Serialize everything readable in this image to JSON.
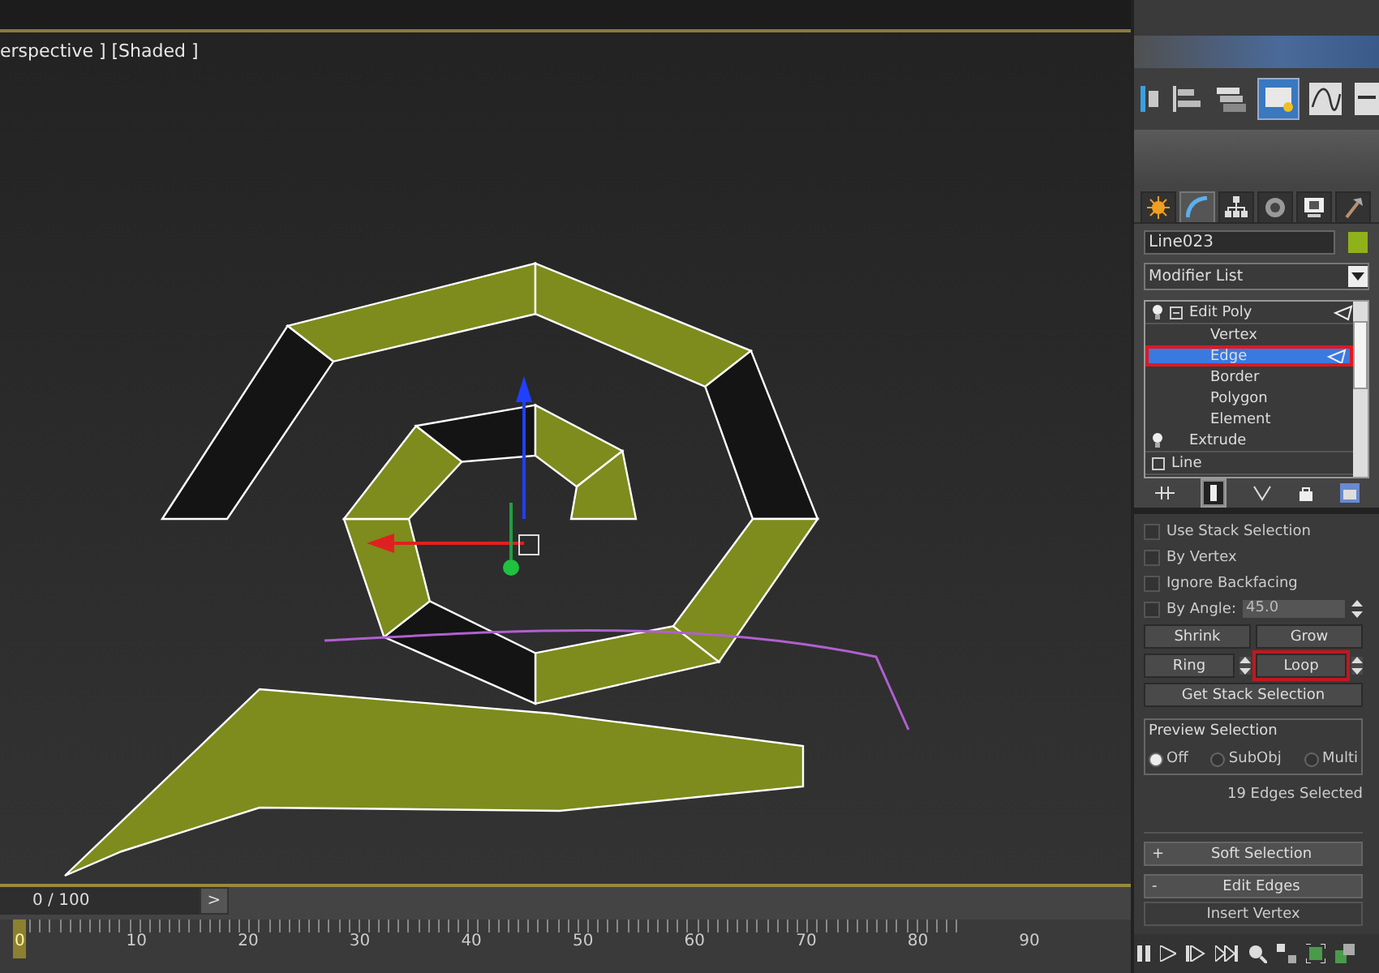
{
  "viewport": {
    "label": "erspective ] [Shaded ]"
  },
  "command_panel": {
    "tabs": [
      {
        "selected": false
      },
      {
        "selected": true
      },
      {
        "selected": false
      },
      {
        "selected": false
      },
      {
        "selected": false
      },
      {
        "selected": false
      }
    ],
    "object_name": "Line023",
    "modifier_list": "Modifier List",
    "stack": [
      {
        "label": "Edit Poly",
        "kind": "modifier",
        "children": [
          {
            "label": "Vertex",
            "selected": false,
            "highlighted": false
          },
          {
            "label": "Edge",
            "selected": true,
            "highlighted": true
          },
          {
            "label": "Border",
            "selected": false,
            "highlighted": false
          },
          {
            "label": "Polygon",
            "selected": false,
            "highlighted": false
          },
          {
            "label": "Element",
            "selected": false,
            "highlighted": false
          }
        ]
      },
      {
        "label": "Extrude",
        "kind": "modifier"
      },
      {
        "label": "Line",
        "kind": "object"
      }
    ],
    "selection": {
      "checks": [
        {
          "label": "Use Stack Selection",
          "checked": false,
          "kind": "plain"
        },
        {
          "label": "By Vertex",
          "checked": false,
          "kind": "plain"
        },
        {
          "label": "Ignore Backfacing",
          "checked": false,
          "kind": "plain"
        },
        {
          "label": "By Angle:",
          "checked": false,
          "kind": "spinner",
          "value": "45.0"
        }
      ],
      "button_rows": [
        [
          {
            "label": "Shrink",
            "kind": "plain",
            "highlighted": false
          },
          {
            "label": "Grow",
            "kind": "plain",
            "highlighted": false
          }
        ],
        [
          {
            "label": "Ring",
            "kind": "spinner",
            "highlighted": false
          },
          {
            "label": "Loop",
            "kind": "spinner",
            "highlighted": true
          }
        ],
        [
          {
            "label": "Get Stack Selection",
            "kind": "plain",
            "highlighted": false
          }
        ]
      ],
      "preview_title": "Preview Selection",
      "preview_options": [
        {
          "label": "Off",
          "selected": true
        },
        {
          "label": "SubObj",
          "selected": false
        },
        {
          "label": "Multi",
          "selected": false
        }
      ],
      "status": "19 Edges Selected"
    },
    "rollouts": [
      {
        "sign": "+",
        "label": "Soft Selection"
      },
      {
        "sign": "-",
        "label": "Edit Edges"
      }
    ],
    "edit_edges_buttons": [
      "Insert Vertex"
    ]
  },
  "timeline": {
    "frame": "0 / 100",
    "next": ">",
    "ticks": [
      "0",
      "10",
      "20",
      "30",
      "40",
      "50",
      "60",
      "70",
      "80",
      "90"
    ]
  }
}
